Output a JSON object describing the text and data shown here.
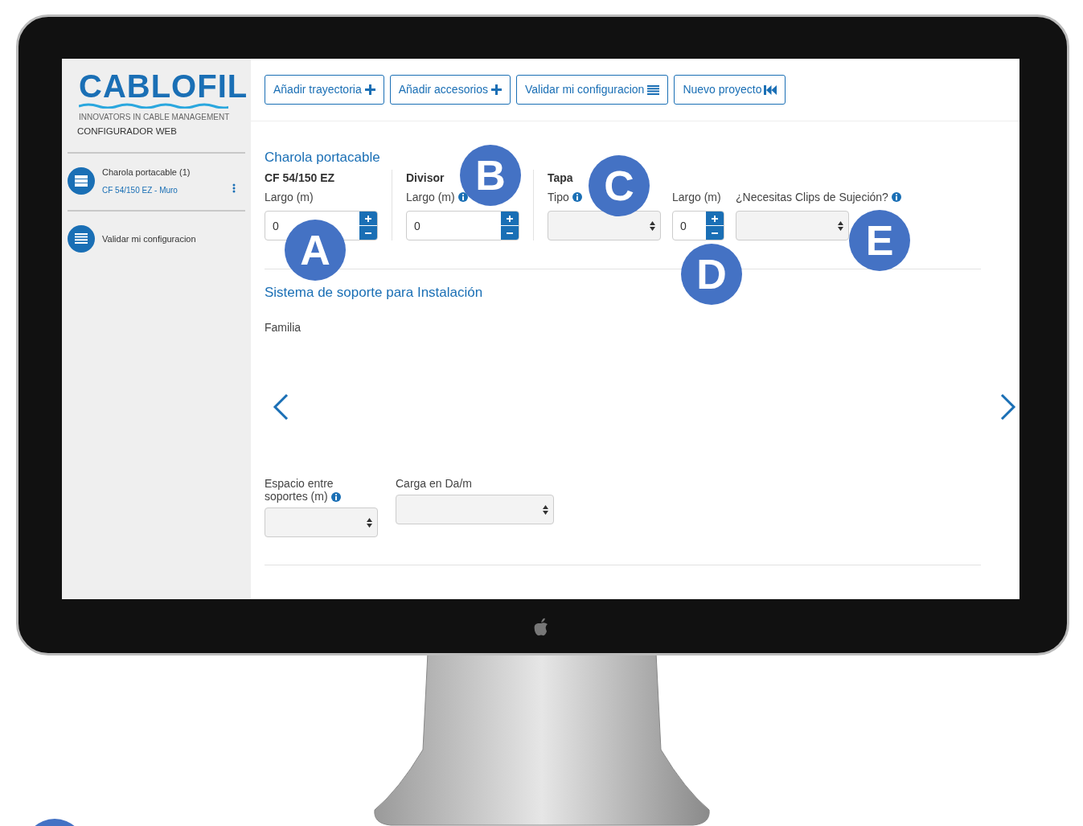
{
  "sidebar": {
    "logo": "CABLOFIL",
    "tagline": "INNOVATORS IN CABLE MANAGEMENT",
    "subtitle": "CONFIGURADOR WEB",
    "items": [
      {
        "kind": "tray",
        "title": "Charola portacable (1)",
        "subtitle": "CF 54/150 EZ - Muro"
      },
      {
        "kind": "list",
        "title": "Validar mi configuracion"
      }
    ]
  },
  "toolbar": [
    {
      "label": "Añadir trayectoria",
      "kind": "add"
    },
    {
      "label": "Añadir accesorios",
      "kind": "add"
    },
    {
      "label": "Validar mi configuracion",
      "kind": "validate"
    },
    {
      "label": "Nuevo proyecto",
      "kind": "reset"
    }
  ],
  "tray_section": {
    "title": "Charola portacable",
    "groups": [
      {
        "heading": "CF 54/150 EZ",
        "fields": [
          {
            "kind": "number",
            "label": "Largo (m)",
            "value": "0"
          }
        ]
      },
      {
        "heading": "Divisor",
        "fields": [
          {
            "kind": "number",
            "label": "Largo (m)",
            "info": true,
            "value": "0"
          }
        ]
      },
      {
        "heading": "Tapa",
        "fields": [
          {
            "kind": "select",
            "label": "Tipo",
            "info": true
          },
          {
            "kind": "number",
            "label": "Largo (m)",
            "value": "0"
          },
          {
            "kind": "select",
            "label": "¿Necesitas Clips de Sujeción?",
            "info": true
          }
        ]
      }
    ]
  },
  "support_section": {
    "title": "Sistema de soporte para Instalación",
    "family_label": "Familia",
    "fields": [
      {
        "kind": "select",
        "label": "Espacio entre soportes (m)",
        "info": true
      },
      {
        "kind": "select",
        "label": "Carga en Da/m"
      }
    ]
  },
  "callouts": [
    "A",
    "B",
    "C",
    "D",
    "E"
  ]
}
